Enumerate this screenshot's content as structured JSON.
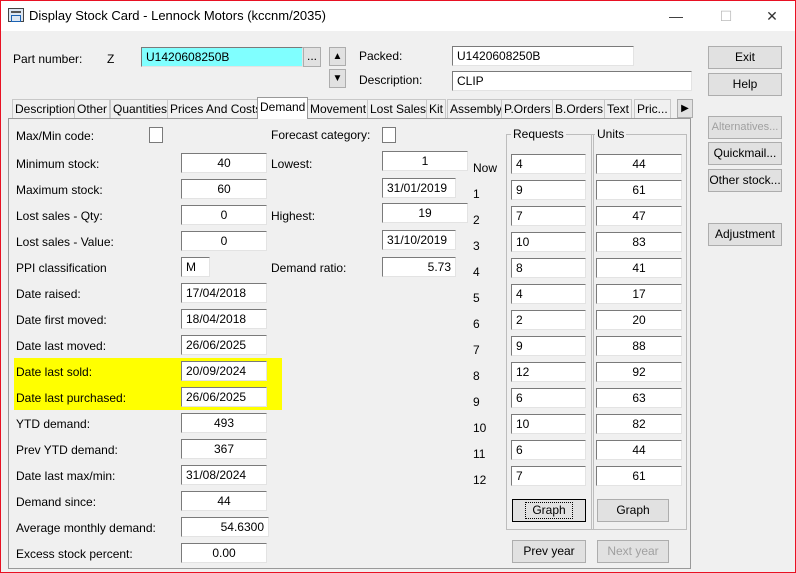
{
  "window": {
    "title": "Display Stock Card - Lennock Motors (kccnm/2035)",
    "controls": {
      "minimize": "—",
      "maximize": "☐",
      "close": "✕"
    }
  },
  "header": {
    "part_number_label": "Part number:",
    "part_prefix": "Z",
    "part_number_value": "U1420608250B",
    "browse_label": "...",
    "packed_label": "Packed:",
    "packed_value": "U1420608250B",
    "description_label": "Description:",
    "description_value": "CLIP"
  },
  "side_buttons": {
    "exit": "Exit",
    "help": "Help",
    "alternatives": "Alternatives...",
    "quickmail": "Quickmail...",
    "other_stock": "Other stock...",
    "adjustment": "Adjustment"
  },
  "tabs": [
    "Description",
    "Other",
    "Quantities",
    "Prices And Costs",
    "Demand",
    "Movement",
    "Lost Sales",
    "Kit",
    "Assembly",
    "P.Orders",
    "B.Orders",
    "Text",
    "Pric..."
  ],
  "active_tab": "Demand",
  "demand": {
    "max_min_code_label": "Max/Min code:",
    "minimum_stock_label": "Minimum stock:",
    "minimum_stock": "40",
    "maximum_stock_label": "Maximum stock:",
    "maximum_stock": "60",
    "lost_sales_qty_label": "Lost sales - Qty:",
    "lost_sales_qty": "0",
    "lost_sales_value_label": "Lost sales - Value:",
    "lost_sales_value": "0",
    "ppi_label": "PPI classification",
    "ppi": "M",
    "date_raised_label": "Date raised:",
    "date_raised": "17/04/2018",
    "date_first_moved_label": "Date first moved:",
    "date_first_moved": "18/04/2018",
    "date_last_moved_label": "Date last moved:",
    "date_last_moved": "26/06/2025",
    "date_last_sold_label": "Date last sold:",
    "date_last_sold": "20/09/2024",
    "date_last_purchased_label": "Date last purchased:",
    "date_last_purchased": "26/06/2025",
    "ytd_demand_label": "YTD demand:",
    "ytd_demand": "493",
    "prev_ytd_demand_label": "Prev YTD demand:",
    "prev_ytd_demand": "367",
    "date_last_maxmin_label": "Date last max/min:",
    "date_last_maxmin": "31/08/2024",
    "demand_since_label": "Demand since:",
    "demand_since": "44",
    "avg_monthly_label": "Average monthly demand:",
    "avg_monthly": "54.6300",
    "excess_stock_label": "Excess stock percent:",
    "excess_stock": "0.00",
    "forecast_label": "Forecast category:",
    "lowest_label": "Lowest:",
    "lowest_value": "1",
    "lowest_date": "31/01/2019",
    "highest_label": "Highest:",
    "highest_value": "19",
    "highest_date": "31/10/2019",
    "demand_ratio_label": "Demand ratio:",
    "demand_ratio": "5.73"
  },
  "history": {
    "requests_label": "Requests",
    "units_label": "Units",
    "periods": [
      "Now",
      "1",
      "2",
      "3",
      "4",
      "5",
      "6",
      "7",
      "8",
      "9",
      "10",
      "11",
      "12"
    ],
    "requests": [
      "4",
      "9",
      "7",
      "10",
      "8",
      "4",
      "2",
      "9",
      "12",
      "6",
      "10",
      "6",
      "7"
    ],
    "units": [
      "44",
      "61",
      "47",
      "83",
      "41",
      "17",
      "20",
      "88",
      "92",
      "63",
      "82",
      "44",
      "61"
    ],
    "graph_label": "Graph",
    "prev_year": "Prev year",
    "next_year": "Next year"
  },
  "colors": {
    "highlight": "#ffff00",
    "part_field": "#80ffff",
    "close_border": "#e81123"
  }
}
